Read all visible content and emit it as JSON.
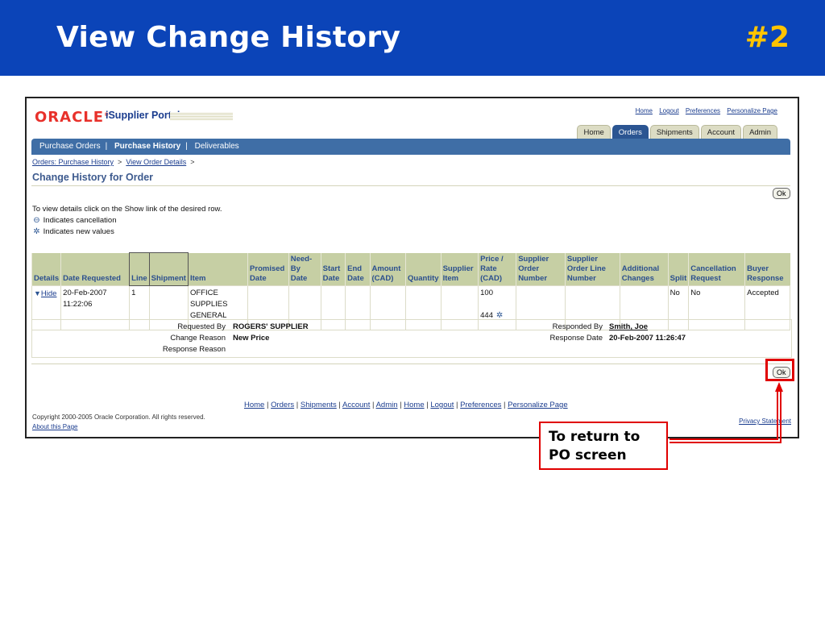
{
  "slide": {
    "title": "View Change History",
    "number": "#2"
  },
  "app": {
    "logo": "ORACLE",
    "portal_name": "iSupplier Portal",
    "global_links": [
      "Home",
      "Logout",
      "Preferences",
      "Personalize Page"
    ],
    "tabs": [
      "Home",
      "Orders",
      "Shipments",
      "Account",
      "Admin"
    ],
    "active_tab": "Orders",
    "subnav": [
      "Purchase Orders",
      "Purchase History",
      "Deliverables"
    ],
    "breadcrumb": {
      "link1": "Orders: Purchase History",
      "link2": "View Order Details",
      "sep": ">"
    },
    "page_title": "Change History for Order",
    "ok_label": "Ok",
    "instructions": {
      "line1": "To view details click on the Show link of the desired row.",
      "line2": "Indicates cancellation",
      "line3": "Indicates new values"
    },
    "table": {
      "headers": [
        "Details",
        "Date Requested",
        "Line",
        "Shipment",
        "Item",
        "Promised Date",
        "Need-By Date",
        "Start Date",
        "End Date",
        "Amount (CAD)",
        "Quantity",
        "Supplier Item",
        "Price / Rate (CAD)",
        "Supplier Order Number",
        "Supplier Order Line Number",
        "Additional Changes",
        "Split",
        "Cancellation Request",
        "Buyer Response"
      ],
      "row": {
        "details": "Hide",
        "date_requested": "20-Feb-2007 11:22:06",
        "line": "1",
        "shipment": "",
        "item": "OFFICE SUPPLIES GENERAL",
        "price_old": "100",
        "price_new": "444",
        "split": "No",
        "cancellation_request": "No",
        "buyer_response": "Accepted"
      }
    },
    "detail": {
      "requested_by_label": "Requested By",
      "requested_by": "ROGERS' SUPPLIER",
      "change_reason_label": "Change Reason",
      "change_reason": "New Price",
      "response_reason_label": "Response Reason",
      "responded_by_label": "Responded By",
      "responded_by": "Smith, Joe",
      "response_date_label": "Response Date",
      "response_date": "20-Feb-2007 11:26:47"
    },
    "footer_links": [
      "Home",
      "Orders",
      "Shipments",
      "Account",
      "Admin",
      "Home",
      "Logout",
      "Preferences",
      "Personalize Page"
    ],
    "copyright": "Copyright 2000-2005 Oracle Corporation. All rights reserved.",
    "about": "About this Page",
    "privacy": "Privacy Statement"
  },
  "callout": {
    "line1": "To return to",
    "line2": "PO screen"
  },
  "colors": {
    "banner": "#0b44b8",
    "slide_number": "#ffc400",
    "highlight": "#e00000",
    "nav": "#3f6ea6",
    "table_header": "#c6cfa4"
  }
}
